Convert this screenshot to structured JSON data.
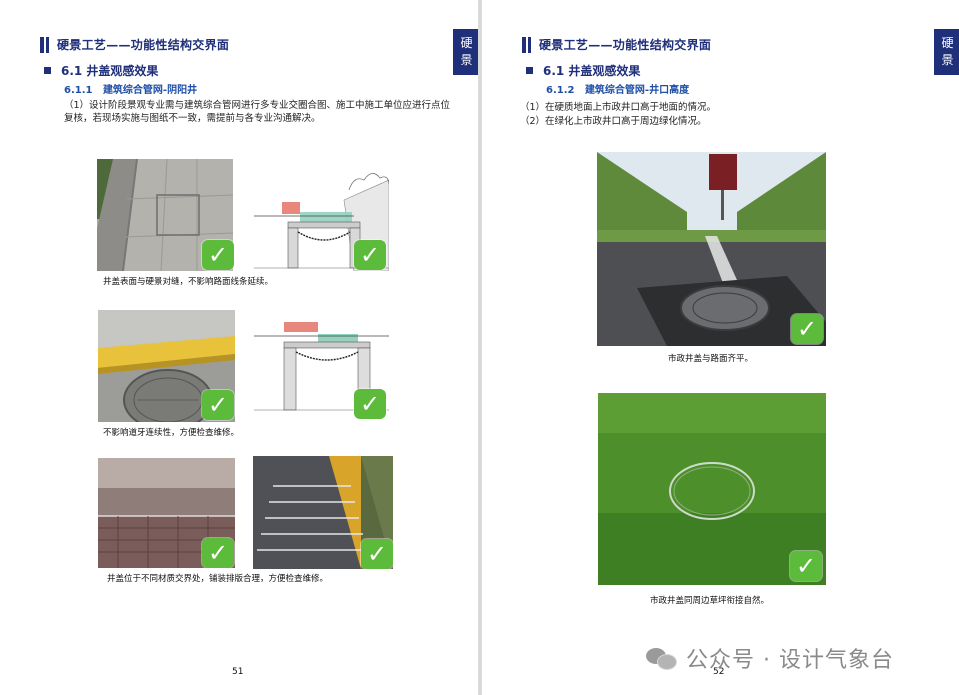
{
  "left_page": {
    "section_title": "硬景工艺——功能性结构交界面",
    "side_tag": [
      "硬",
      "景"
    ],
    "h2": "6.1 井盖观感效果",
    "h3_num": "6.1.1",
    "h3_title": "建筑综合管网-阴阳井",
    "paragraph": "（1）设计阶段景观专业需与建筑综合管网进行多专业交圈合图、施工中施工单位应进行点位复核，若现场实施与图纸不一致，需提前与各专业沟通解决。",
    "captions": [
      "井盖表面与硬景对缝，不影响路面线条延续。",
      "不影响道牙连续性，方便检查维修。",
      "井盖位于不同材质交界处，铺装排版合理，方便检查维修。"
    ],
    "page_number": "51"
  },
  "right_page": {
    "section_title": "硬景工艺——功能性结构交界面",
    "side_tag": [
      "硬",
      "景"
    ],
    "h2": "6.1 井盖观感效果",
    "h3_num": "6.1.2",
    "h3_title": "建筑综合管网-井口高度",
    "items": [
      "（1）在硬质地面上市政井口高于地面的情况。",
      "（2）在绿化上市政井口高于周边绿化情况。"
    ],
    "captions": [
      "市政井盖与路面齐平。",
      "市政井盖同周边草坪衔接自然。"
    ],
    "page_number": "52"
  },
  "watermark": "公众号 · 设计气象台",
  "check_glyph": "✓",
  "colors": {
    "navy": "#1f2f7a",
    "blue": "#1f4ea8",
    "check_green": "#5cbb3a"
  }
}
